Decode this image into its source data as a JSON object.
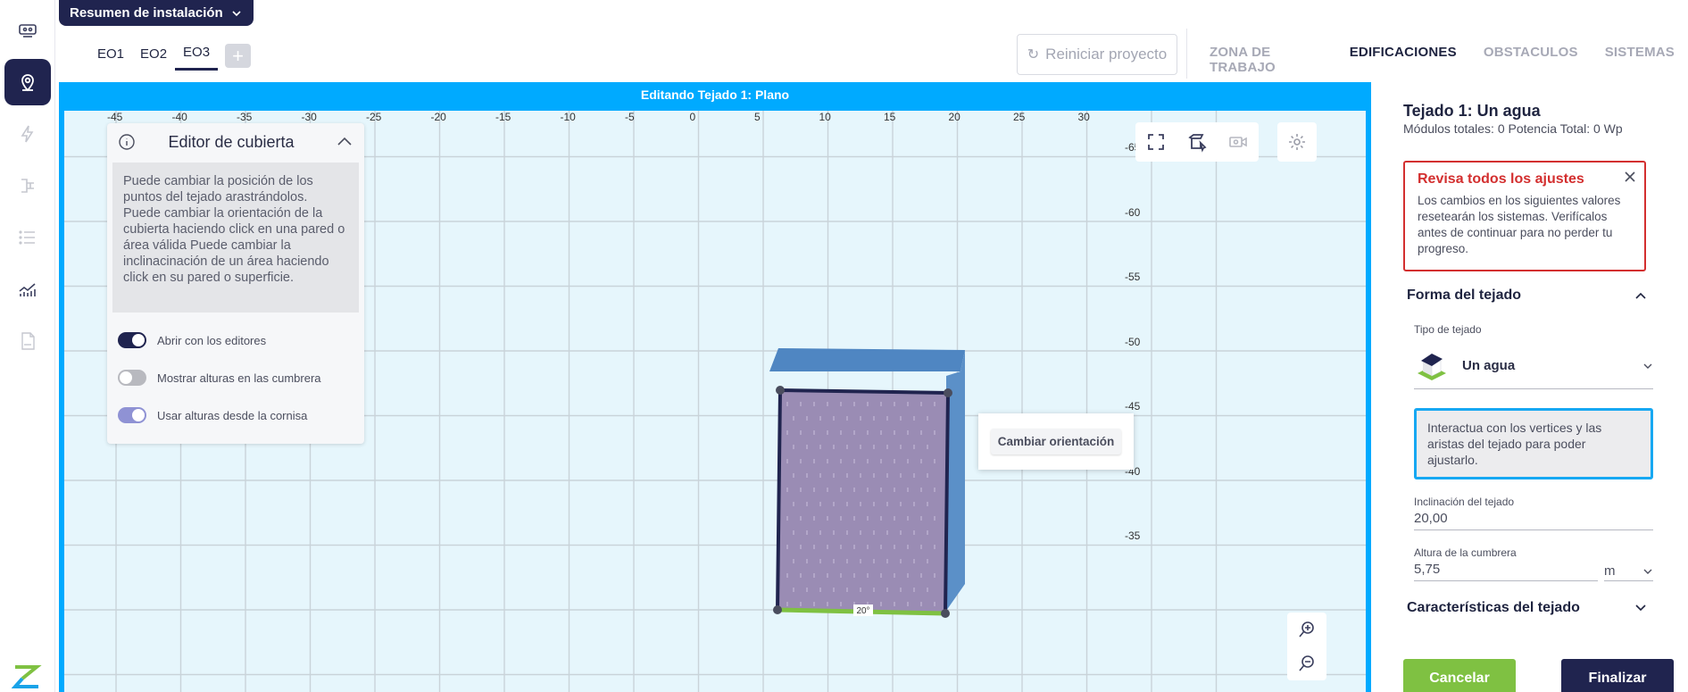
{
  "header": {
    "summary_label": "Resumen de instalación",
    "building_tabs": [
      {
        "label": "EO1",
        "active": false
      },
      {
        "label": "EO2",
        "active": false
      },
      {
        "label": "EO3",
        "active": true
      }
    ],
    "add_tab_label": "+",
    "restart_label": "Reiniciar proyecto",
    "nav": [
      {
        "label": "ZONA DE TRABAJO",
        "active": false
      },
      {
        "label": "EDIFICACIONES",
        "active": true
      },
      {
        "label": "OBSTACULOS",
        "active": false
      },
      {
        "label": "SISTEMAS",
        "active": false
      }
    ]
  },
  "sidebar": {
    "items": [
      {
        "name": "solar-panel-icon",
        "active": false
      },
      {
        "name": "map-pin-icon",
        "active": true
      },
      {
        "name": "lightning-icon",
        "active": false
      },
      {
        "name": "circuit-icon",
        "active": false
      },
      {
        "name": "list-icon",
        "active": false
      },
      {
        "name": "chart-icon",
        "active": false
      },
      {
        "name": "pdf-icon",
        "active": false
      }
    ]
  },
  "canvas": {
    "banner": "Editando Tejado 1: Plano",
    "x_ticks": [
      "-45",
      "-40",
      "-35",
      "-30",
      "-25",
      "-20",
      "-15",
      "-10",
      "-5",
      "0",
      "5",
      "10",
      "15",
      "20",
      "25",
      "30"
    ],
    "y_ticks": [
      "-65",
      "-60",
      "-55",
      "-50",
      "-45",
      "-40",
      "-35"
    ],
    "slope_label": "20°",
    "context_menu_option": "Cambiar orientación"
  },
  "editor": {
    "title": "Editor de cubierta",
    "help_text": "Puede cambiar la posición de los puntos del tejado arastrándolos. Puede cambiar la orientación de la cubierta haciendo click en una pared o área válida Puede cambiar la inclinacinación de un área haciendo click en su pared o superficie.",
    "toggles": [
      {
        "label": "Abrir con los editores",
        "state": "on"
      },
      {
        "label": "Mostrar alturas en las cumbrera",
        "state": "off"
      },
      {
        "label": "Usar alturas desde la cornisa",
        "state": "on-light"
      }
    ]
  },
  "panel": {
    "title": "Tejado 1: Un agua",
    "subtitle": "Módulos totales: 0 Potencia Total: 0 Wp",
    "alert": {
      "title": "Revisa todos los ajustes",
      "text": "Los cambios en los siguientes valores resetearán los sistemas. Verifícalos antes de continuar para no perder tu progreso."
    },
    "shape_section": "Forma del tejado",
    "roof_type_label": "Tipo de tejado",
    "roof_type_value": "Un agua",
    "info_text": "Interactua con los vertices y las aristas del tejado para poder ajustarlo.",
    "slope_label": "Inclinación del tejado",
    "slope_value": "20,00",
    "ridge_label": "Altura de la cumbrera",
    "ridge_value": "5,75",
    "ridge_unit": "m",
    "features_section": "Características del tejado",
    "cancel_label": "Cancelar",
    "finish_label": "Finalizar"
  },
  "colors": {
    "brand_navy": "#20244f",
    "accent_blue": "#00aaff",
    "alert_red": "#d32f2f",
    "cancel_green": "#7fc142",
    "roof_purple": "#9a8cb4",
    "wall_blue": "#4f86c2"
  }
}
